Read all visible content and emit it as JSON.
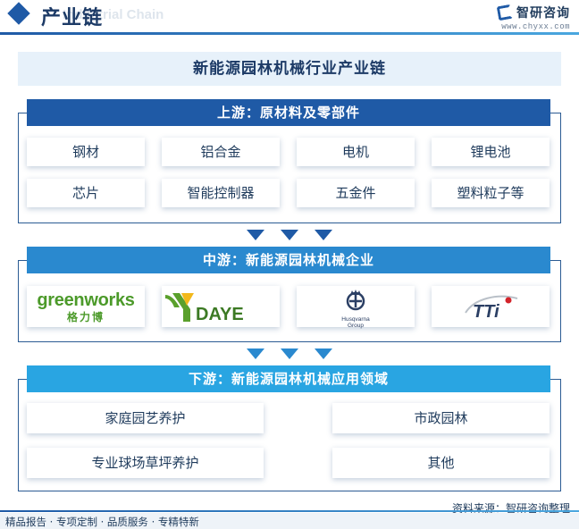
{
  "header": {
    "title": "产业链",
    "watermark": "Industrial Chain",
    "brand_name": "智研咨询",
    "brand_url": "www.chyxx.com"
  },
  "main_title": "新能源园林机械行业产业链",
  "upstream": {
    "label": "上游：原材料及零部件",
    "items": [
      "钢材",
      "铝合金",
      "电机",
      "锂电池",
      "芯片",
      "智能控制器",
      "五金件",
      "塑料粒子等"
    ]
  },
  "midstream": {
    "label": "中游：新能源园林机械企业",
    "logos": {
      "greenworks_name": "greenworks",
      "greenworks_cn": "格力博",
      "daye_name": "DAYE",
      "husqvarna_name": "Husqvarna",
      "husqvarna_sub": "Group",
      "tti_name": "TTi"
    }
  },
  "downstream": {
    "label": "下游：新能源园林机械应用领域",
    "items": [
      "家庭园艺养护",
      "市政园林",
      "专业球场草坪养护",
      "其他"
    ]
  },
  "source": "资料来源：智研咨询整理",
  "footer": "精品报告 · 专项定制 · 品质服务 · 专精特新",
  "colors": {
    "dark_blue": "#1f5aa6",
    "mid_blue": "#2a89cf",
    "light_blue": "#29a5e2",
    "greenworks_green": "#4c9a2a",
    "daye_green": "#5aa02c",
    "daye_yellow": "#f2b81b",
    "tti_red": "#d3232a"
  }
}
